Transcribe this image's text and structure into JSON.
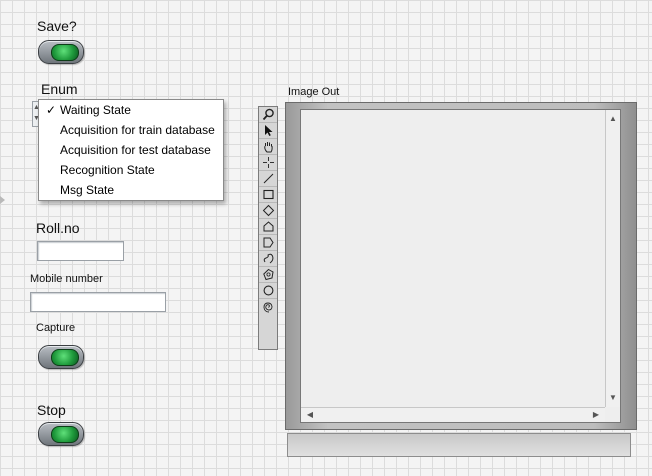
{
  "controls": {
    "save_label": "Save?",
    "enum_label": "Enum",
    "rollno_label": "Roll.no",
    "rollno_value": "",
    "mobile_label": "Mobile number",
    "mobile_value": "",
    "capture_label": "Capture",
    "stop_label": "Stop"
  },
  "enum_menu": {
    "selected": "Waiting State",
    "items": [
      "Waiting State",
      "Acquisition for train database",
      "Acquisition for test database",
      "Recognition State",
      "Msg State"
    ]
  },
  "image_display": {
    "label": "Image Out"
  },
  "palette_tools": [
    "zoom-icon",
    "pointer-icon",
    "pan-hand-icon",
    "crosshair-icon",
    "line-tool-icon",
    "rectangle-tool-icon",
    "diamond-tool-icon",
    "polygon-tool-icon",
    "freehand-polygon-icon",
    "freehand-line-icon",
    "annulus-tool-icon",
    "oval-tool-icon",
    "spiral-tool-icon"
  ],
  "colors": {
    "led_green": "#2fbf4f",
    "grid": "#dcdcdc"
  }
}
